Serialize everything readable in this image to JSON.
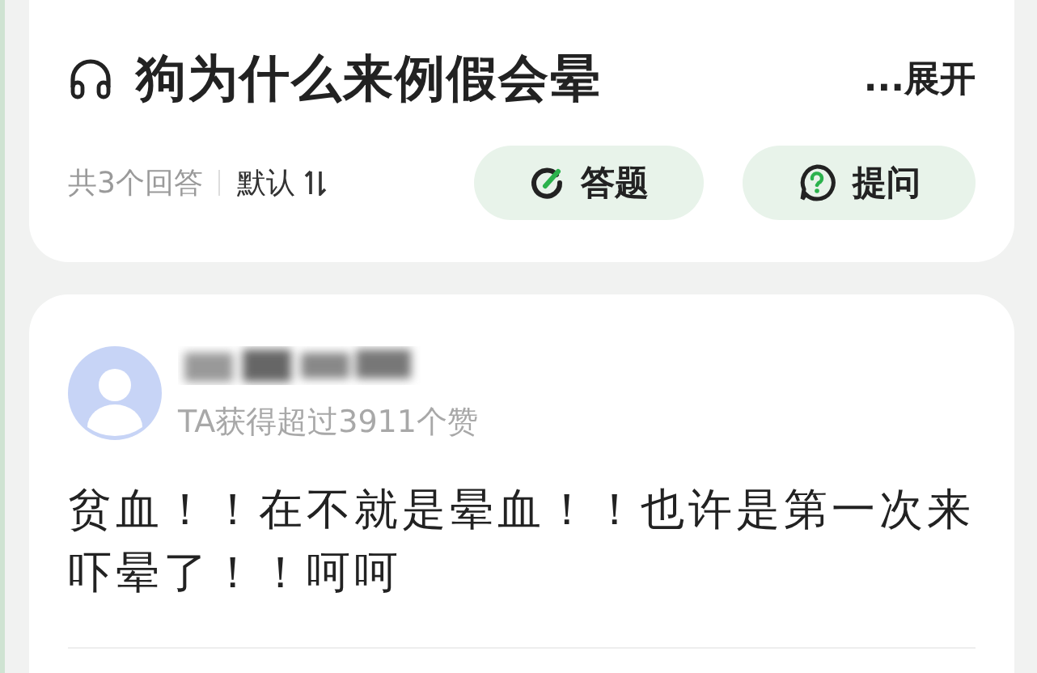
{
  "question": {
    "title": "狗为什么来例假会晕",
    "expand": "...展开",
    "answer_count": "共3个回答",
    "sort": "默认"
  },
  "buttons": [
    {
      "kind": "answer",
      "label": "答题"
    },
    {
      "kind": "ask",
      "label": "提问"
    }
  ],
  "answer": {
    "author_stats": "TA获得超过3911个赞",
    "text": "贫血！！在不就是晕血！！也许是第一次来吓晕了！！呵呵"
  }
}
